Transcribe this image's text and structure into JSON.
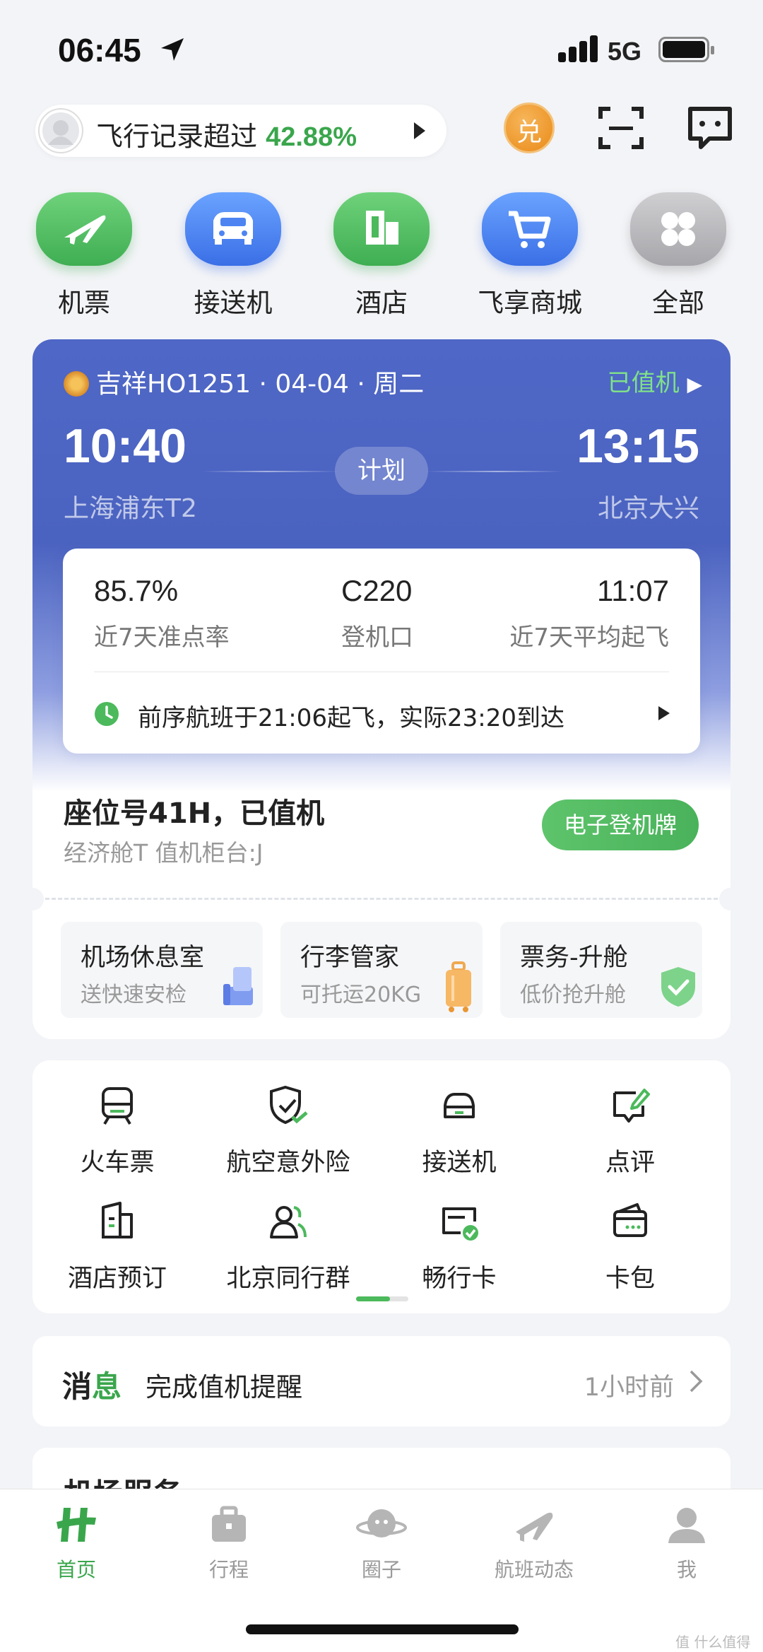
{
  "status_bar": {
    "time": "06:45",
    "network": "5G"
  },
  "header": {
    "record_prefix": "飞行记录超过",
    "record_percent": "42.88%",
    "redeem_badge": "兑"
  },
  "quick_entries": [
    {
      "label": "机票",
      "icon": "plane-icon"
    },
    {
      "label": "接送机",
      "icon": "car-icon"
    },
    {
      "label": "酒店",
      "icon": "building-icon"
    },
    {
      "label": "飞享商城",
      "icon": "cart-icon"
    },
    {
      "label": "全部",
      "icon": "clover-icon"
    }
  ],
  "flight": {
    "airline_flight": "吉祥HO1251 · 04-04 · 周二",
    "status": "已值机",
    "dep_time": "10:40",
    "dep_airport": "上海浦东T2",
    "arr_time": "13:15",
    "arr_airport": "北京大兴",
    "plan_label": "计划",
    "stats": [
      {
        "value": "85.7%",
        "label": "近7天准点率"
      },
      {
        "value": "C220",
        "label": "登机口"
      },
      {
        "value": "11:07",
        "label": "近7天平均起飞"
      }
    ],
    "prev_flight": "前序航班于21:06起飞，实际23:20到达",
    "seat": "座位号41H，已值机",
    "seat_sub": "经济舱T 值机柜台:J",
    "boarding_button": "电子登机牌",
    "services": [
      {
        "title": "机场休息室",
        "sub": "送快速安检"
      },
      {
        "title": "行李管家",
        "sub": "可托运20KG"
      },
      {
        "title": "票务-升舱",
        "sub": "低价抢升舱"
      }
    ]
  },
  "grid": [
    {
      "label": "火车票",
      "icon": "train-icon"
    },
    {
      "label": "航空意外险",
      "icon": "shield-check-icon"
    },
    {
      "label": "接送机",
      "icon": "car-outline-icon"
    },
    {
      "label": "点评",
      "icon": "review-icon"
    },
    {
      "label": "酒店预订",
      "icon": "hotel-icon"
    },
    {
      "label": "北京同行群",
      "icon": "group-icon"
    },
    {
      "label": "畅行卡",
      "icon": "card-check-icon"
    },
    {
      "label": "卡包",
      "icon": "wallet-icon"
    }
  ],
  "message": {
    "tag_a": "消",
    "tag_b": "息",
    "text": "完成值机提醒",
    "time": "1小时前"
  },
  "airport_service": {
    "title": "机场服务"
  },
  "tabs": [
    {
      "label": "首页",
      "active": true
    },
    {
      "label": "行程",
      "active": false
    },
    {
      "label": "圈子",
      "active": false
    },
    {
      "label": "航班动态",
      "active": false
    },
    {
      "label": "我",
      "active": false
    }
  ],
  "colors": {
    "brand_green": "#3aa64c",
    "card_blue": "#4f67c6"
  }
}
